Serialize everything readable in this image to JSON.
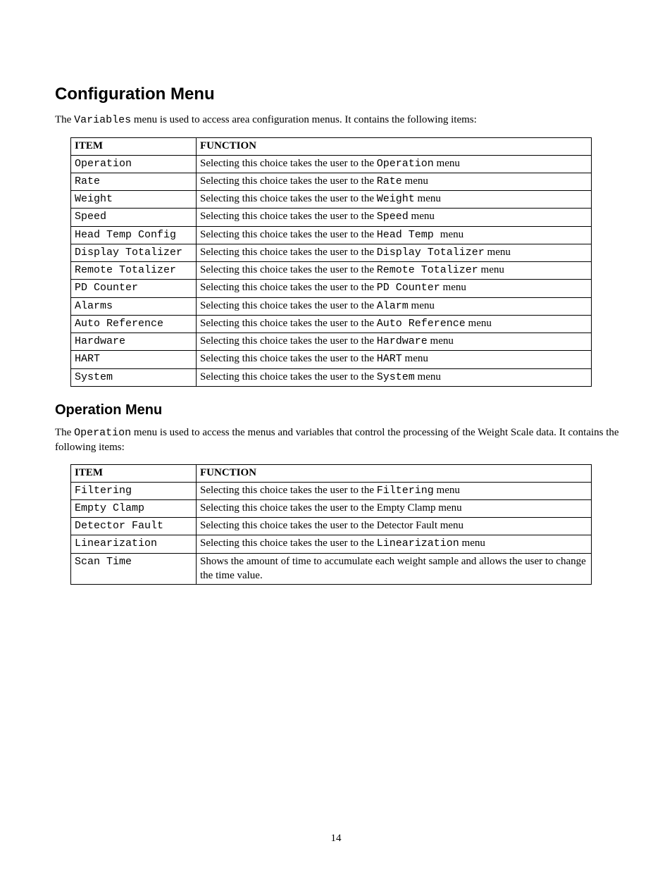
{
  "page_number": "14",
  "section1": {
    "title": "Configuration Menu",
    "intro_prefix": "The ",
    "intro_mono": "Variables",
    "intro_suffix": " menu is used to access area configuration menus. It contains the following items:",
    "headers": {
      "item": "ITEM",
      "function": "FUNCTION"
    },
    "rows": [
      {
        "item": "Operation",
        "func_pre": "Selecting this choice takes the user to the ",
        "func_mono": "Operation",
        "func_suf": " menu"
      },
      {
        "item": "Rate",
        "func_pre": "Selecting this choice takes the user to the ",
        "func_mono": "Rate",
        "func_suf": " menu"
      },
      {
        "item": "Weight",
        "func_pre": "Selecting this choice takes the user to the ",
        "func_mono": "Weight",
        "func_suf": " menu"
      },
      {
        "item": "Speed",
        "func_pre": "Selecting this choice takes the user to the ",
        "func_mono": "Speed",
        "func_suf": " menu"
      },
      {
        "item": "Head Temp Config",
        "func_pre": "Selecting this choice takes the user to the ",
        "func_mono": "Head Temp ",
        "func_suf": " menu"
      },
      {
        "item": "Display Totalizer",
        "func_pre": "Selecting this choice takes the user to the ",
        "func_mono": "Display Totalizer",
        "func_suf": " menu"
      },
      {
        "item": "Remote Totalizer",
        "func_pre": "Selecting this choice takes the user to the ",
        "func_mono": "Remote Totalizer",
        "func_suf": " menu"
      },
      {
        "item": "PD Counter",
        "func_pre": "Selecting this choice takes the user to the ",
        "func_mono": "PD Counter",
        "func_suf": " menu"
      },
      {
        "item": "Alarms",
        "func_pre": "Selecting this choice takes the user to the ",
        "func_mono": "Alarm",
        "func_suf": " menu"
      },
      {
        "item": "Auto Reference",
        "func_pre": "Selecting this choice takes the user to the ",
        "func_mono": "Auto Reference",
        "func_suf": " menu"
      },
      {
        "item": "Hardware",
        "func_pre": "Selecting this choice takes the user to the ",
        "func_mono": "Hardware",
        "func_suf": " menu"
      },
      {
        "item": "HART",
        "func_pre": "Selecting this choice takes the user to the ",
        "func_mono": "HART",
        "func_suf": " menu"
      },
      {
        "item": "System",
        "func_pre": "Selecting this choice takes the user to the ",
        "func_mono": "System",
        "func_suf": " menu"
      }
    ]
  },
  "section2": {
    "title": "Operation Menu",
    "intro_prefix": "The ",
    "intro_mono": "Operation",
    "intro_suffix": " menu is used to access the menus and variables that control the processing of the Weight Scale data. It contains the following items:",
    "headers": {
      "item": "ITEM",
      "function": "FUNCTION"
    },
    "rows": [
      {
        "item": "Filtering",
        "func_pre": "Selecting this choice takes the user to the ",
        "func_mono": "Filtering",
        "func_suf": " menu"
      },
      {
        "item": "Empty Clamp",
        "func_pre": "Selecting this choice takes the user to the Empty Clamp menu",
        "func_mono": "",
        "func_suf": ""
      },
      {
        "item": "Detector Fault",
        "func_pre": "Selecting this choice takes the user to the Detector Fault menu",
        "func_mono": "",
        "func_suf": ""
      },
      {
        "item": "Linearization",
        "func_pre": "Selecting this choice takes the user to the ",
        "func_mono": "Linearization",
        "func_suf": " menu"
      },
      {
        "item": "Scan Time",
        "func_pre": "Shows the amount of time to accumulate each weight sample and allows the user to change the time value.",
        "func_mono": "",
        "func_suf": ""
      }
    ]
  }
}
